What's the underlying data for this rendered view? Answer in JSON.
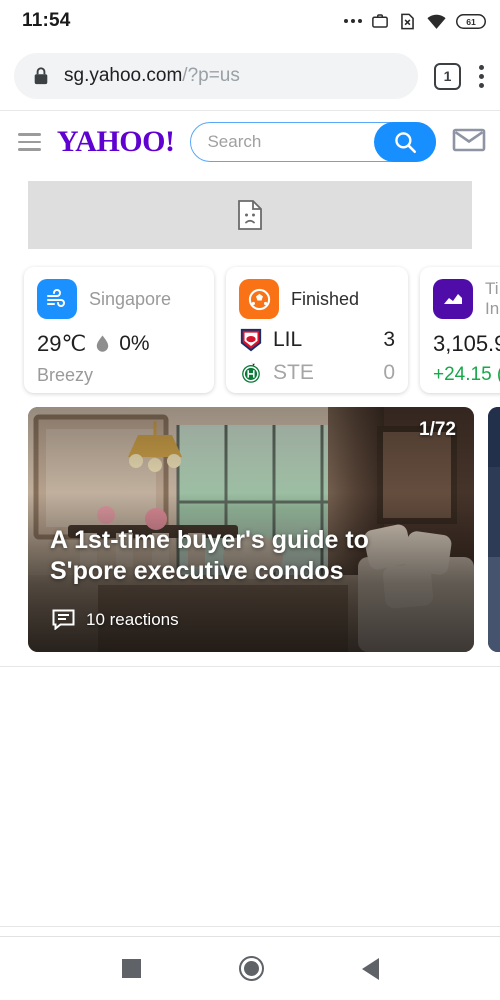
{
  "status_bar": {
    "time": "11:54",
    "battery_level": "61",
    "icons": [
      "more-dots",
      "briefcase-work-profile",
      "sim-card-off",
      "wifi",
      "battery"
    ]
  },
  "browser": {
    "url_host": "sg.yahoo.com",
    "url_path": "/?p=us",
    "security": "lock-icon",
    "tab_count": "1",
    "menu": "overflow-menu"
  },
  "site_header": {
    "logo": "YAHOO!",
    "menu_icon": "hamburger-icon",
    "mail_icon": "mail-icon",
    "search": {
      "placeholder": "Search",
      "value": "",
      "button_icon": "search-icon"
    }
  },
  "ad_banner": {
    "state": "broken-image",
    "icon": "broken-image-icon"
  },
  "cards": {
    "weather": {
      "icon": "wind-icon",
      "icon_color": "#1a91ff",
      "location": "Singapore",
      "temperature": "29℃",
      "precip_icon": "droplet-icon",
      "precipitation": "0%",
      "condition": "Breezy"
    },
    "sports": {
      "icon": "soccer-ball-icon",
      "icon_color": "#f97316",
      "status": "Finished",
      "teams": [
        {
          "crest": "lille-crest",
          "abbr": "LIL",
          "score": "3"
        },
        {
          "crest": "saint-etienne-crest",
          "abbr": "STE",
          "score": "0"
        }
      ]
    },
    "finance": {
      "icon": "line-chart-icon",
      "icon_color": "#4f0ca8",
      "name_line1": "Ti",
      "name_line2": "In",
      "value": "3,105.9",
      "change": "+24.15 (",
      "change_color": "#17a84a"
    }
  },
  "carousel": {
    "counter": "1/72",
    "headline": "A 1st-time buyer's guide to S'pore executive condos",
    "reactions_icon": "comment-icon",
    "reactions": "10 reactions"
  },
  "android_nav": {
    "recents": "recents-square-icon",
    "home": "home-circle-icon",
    "back": "back-triangle-icon"
  }
}
